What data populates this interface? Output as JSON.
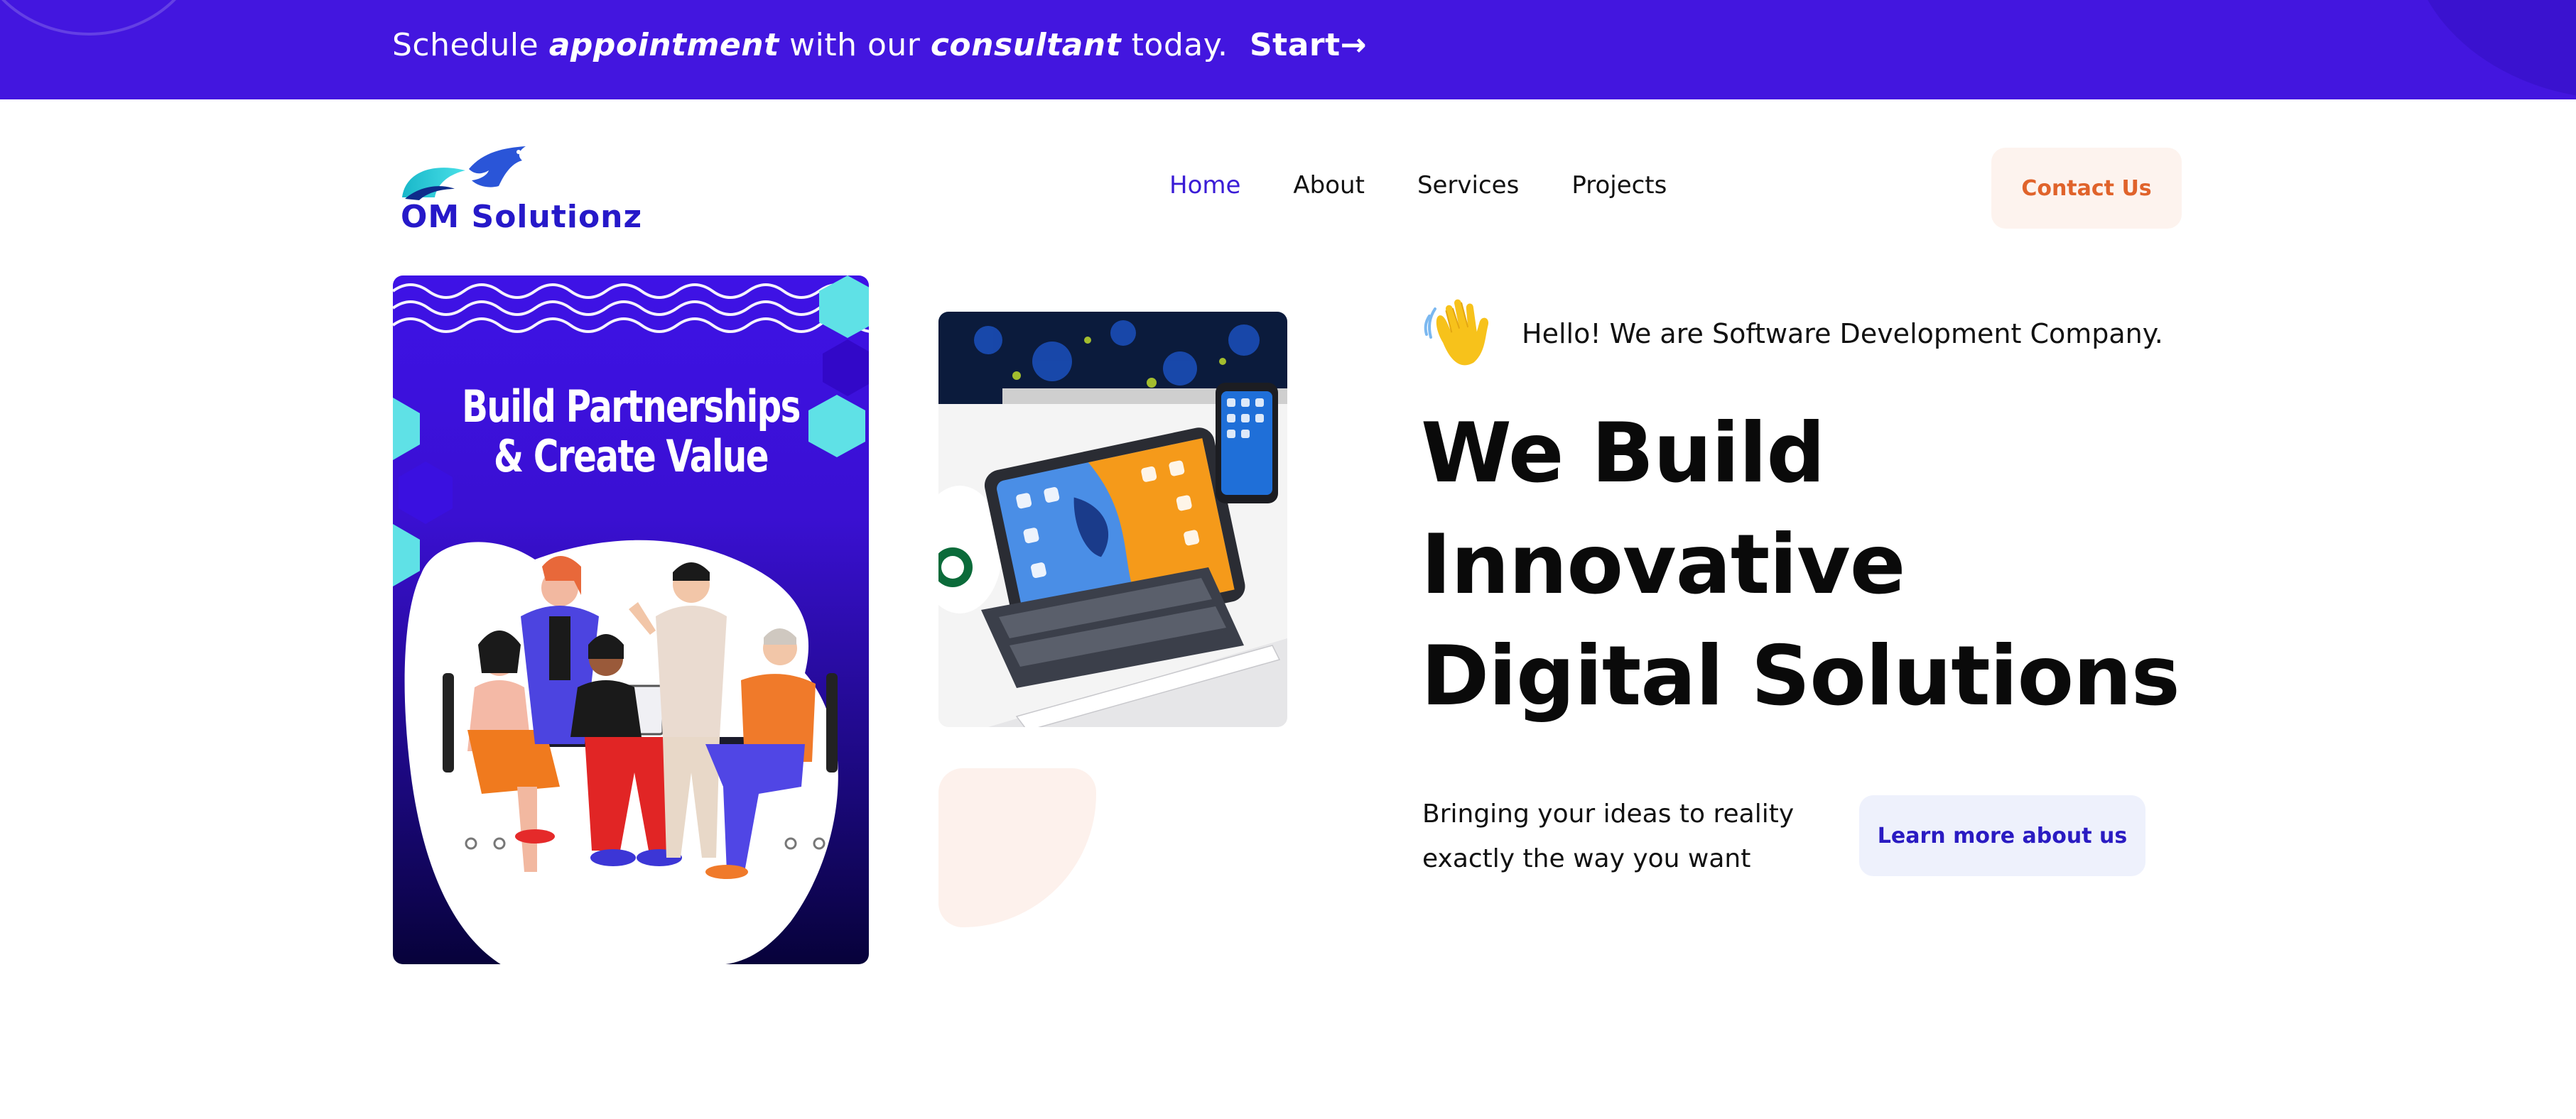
{
  "banner": {
    "text_1": "Schedule",
    "text_2": "appointment",
    "text_3": "with our",
    "text_4": "consultant",
    "text_5": "today.",
    "start_label": "Start→"
  },
  "logo": {
    "text": "OM Solutionz"
  },
  "nav": {
    "items": [
      {
        "label": "Home",
        "active": true
      },
      {
        "label": "About",
        "active": false
      },
      {
        "label": "Services",
        "active": false
      },
      {
        "label": "Projects",
        "active": false
      }
    ]
  },
  "header": {
    "contact_label": "Contact Us"
  },
  "poster": {
    "title_line_1": "Build Partnerships",
    "title_line_2": "& Create Value"
  },
  "hero": {
    "greeting": "Hello! We are Software Development Company.",
    "headline_line_1": "We Build",
    "headline_line_2": "Innovative",
    "headline_line_3": "Digital Solutions",
    "tagline_line_1": "Bringing your ideas to reality",
    "tagline_line_2": "exactly the way you want",
    "learn_more_label": "Learn more about us"
  },
  "colors": {
    "brand_purple": "#4316df",
    "nav_active": "#3a1cd6",
    "contact_text": "#e0632b",
    "contact_bg": "#fdf3ee",
    "learn_bg": "#eef1fc",
    "learn_text": "#2a1bc2"
  }
}
